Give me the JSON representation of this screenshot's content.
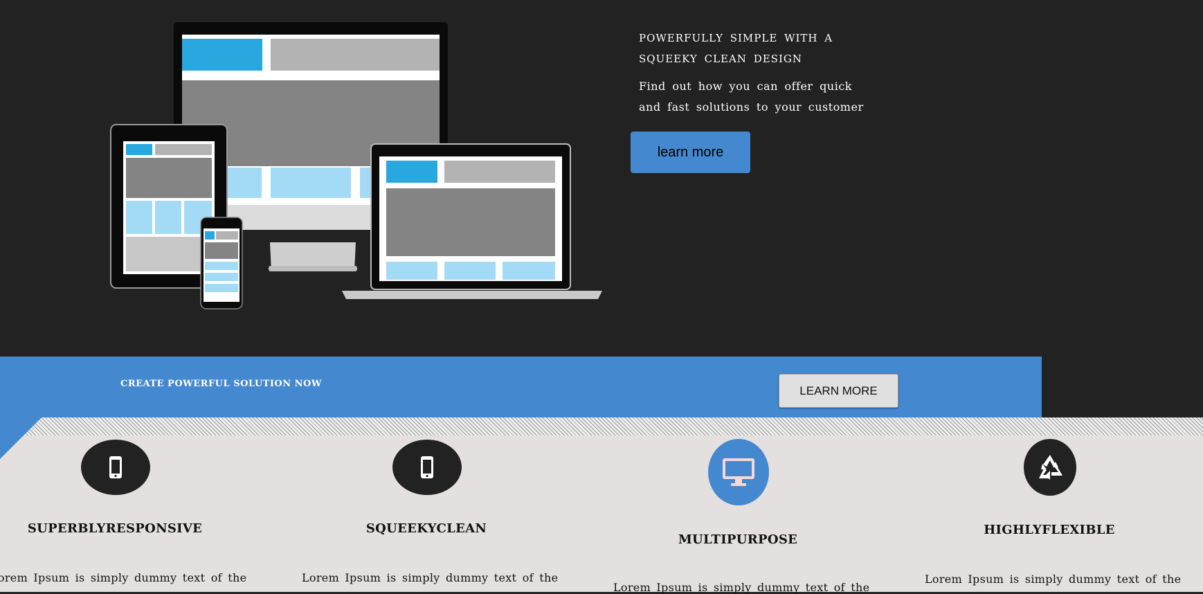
{
  "hero": {
    "title": "POWERFULLY SIMPLE      WITH A SQUEEKY CLEAN DESIGN",
    "subtitle": "Find out how you can offer quick and fast solutions to your customer",
    "button_label": "learn more"
  },
  "band": {
    "title": "CREATE POWERFUL SOLUTION NOW",
    "button_label": "LEARN MORE"
  },
  "features": [
    {
      "icon": "smartphone-icon",
      "title": "SUPERBLYRESPONSIVE",
      "text": "Lorem Ipsum is simply dummy text of the"
    },
    {
      "icon": "smartphone-icon",
      "title": "SQUEEKYCLEAN",
      "text": "Lorem Ipsum is simply dummy text of the"
    },
    {
      "icon": "desktop-icon",
      "title": "MULTIPURPOSE",
      "text": "Lorem Ipsum is simply dummy text of the"
    },
    {
      "icon": "recycle-icon",
      "title": "HIGHLYFLEXIBLE",
      "text": "Lorem Ipsum is simply dummy text of the"
    }
  ],
  "colors": {
    "accent": "#4488cf",
    "dark": "#222222",
    "light_panel": "#e3e0df"
  }
}
